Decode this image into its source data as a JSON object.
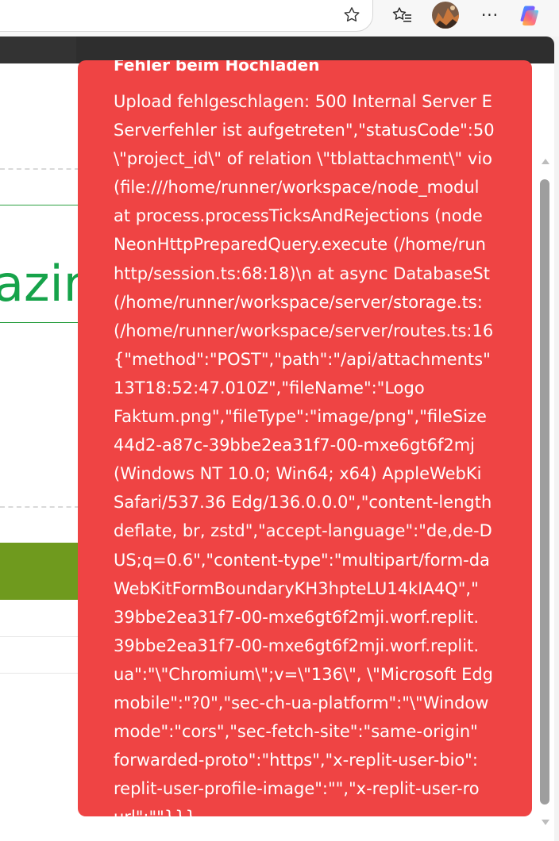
{
  "browser": {
    "toolbar_icons": [
      "star-icon",
      "favorites-icon",
      "profile-avatar",
      "more-icon",
      "copilot-icon"
    ],
    "more_label": "···"
  },
  "page": {
    "partial_heading": "azin",
    "colors": {
      "accent_green": "#16a34a",
      "olive_button": "#6f9a1e"
    }
  },
  "toast": {
    "title": "Fehler beim Hochladen",
    "background": "#ef4444",
    "lines": [
      "Upload fehlgeschlagen: 500 Internal Server E",
      "Serverfehler ist aufgetreten\",\"statusCode\":50",
      "\\\"project_id\\\" of relation \\\"tblattachment\\\" vio",
      "(file:///home/runner/workspace/node_modul",
      "at process.processTicksAndRejections (node",
      "NeonHttpPreparedQuery.execute (/home/run",
      "http/session.ts:68:18)\\n at async DatabaseSt",
      "(/home/runner/workspace/server/storage.ts:",
      "(/home/runner/workspace/server/routes.ts:16",
      "{\"method\":\"POST\",\"path\":\"/api/attachments\"",
      "13T18:52:47.010Z\",\"fileName\":\"Logo",
      "Faktum.png\",\"fileType\":\"image/png\",\"fileSize",
      "44d2-a87c-39bbe2ea31f7-00-mxe6gt6f2mj",
      "(Windows NT 10.0; Win64; x64) AppleWebKi",
      "Safari/537.36 Edg/136.0.0.0\",\"content-length",
      "deflate, br, zstd\",\"accept-language\":\"de,de-D",
      "US;q=0.6\",\"content-type\":\"multipart/form-da",
      "WebKitFormBoundaryKH3hpteLU14kIA4Q\",\"",
      "39bbe2ea31f7-00-mxe6gt6f2mji.worf.replit.",
      "39bbe2ea31f7-00-mxe6gt6f2mji.worf.replit.",
      "ua\":\"\\\"Chromium\\\";v=\\\"136\\\", \\\"Microsoft Edg",
      "mobile\":\"?0\",\"sec-ch-ua-platform\":\"\\\"Window",
      "mode\":\"cors\",\"sec-fetch-site\":\"same-origin\"",
      "forwarded-proto\":\"https\",\"x-replit-user-bio\":",
      "replit-user-profile-image\":\"\",\"x-replit-user-ro",
      "url\":\"\"}}}"
    ]
  }
}
